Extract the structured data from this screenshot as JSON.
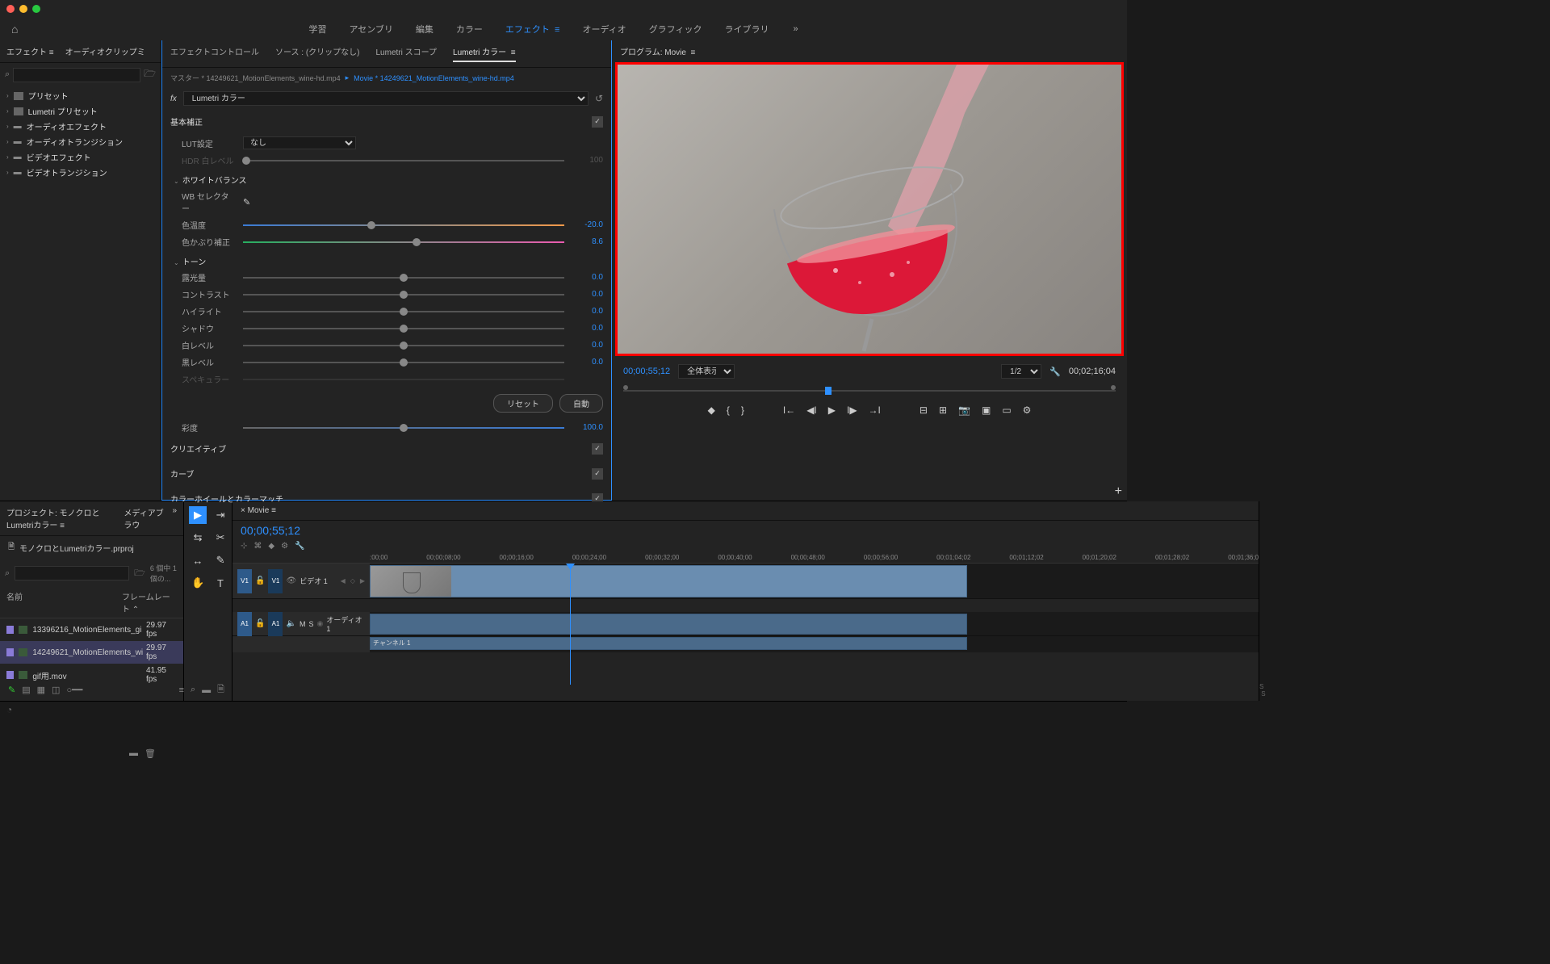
{
  "workspace_tabs": [
    "学習",
    "アセンブリ",
    "編集",
    "カラー",
    "エフェクト",
    "オーディオ",
    "グラフィック",
    "ライブラリ"
  ],
  "workspace_active": 4,
  "effects_panel": {
    "tab1": "エフェクト",
    "tab2": "オーディオクリップミ",
    "search_placeholder": "",
    "tree": [
      "プリセット",
      "Lumetri プリセット",
      "オーディオエフェクト",
      "オーディオトランジション",
      "ビデオエフェクト",
      "ビデオトランジション"
    ]
  },
  "center": {
    "tabs": [
      "エフェクトコントロール",
      "ソース : (クリップなし)",
      "Lumetri スコープ",
      "Lumetri カラー"
    ],
    "active": 3,
    "master": "マスター * 14249621_MotionElements_wine-hd.mp4",
    "clip": "Movie * 14249621_MotionElements_wine-hd.mp4",
    "fx_name": "Lumetri カラー",
    "basic": "基本補正",
    "lut_label": "LUT設定",
    "lut_value": "なし",
    "hdr_label": "HDR 白レベル",
    "hdr_value": "100",
    "wb_header": "ホワイトバランス",
    "wb_selector": "WB セレクター",
    "temp_label": "色温度",
    "temp_value": "-20.0",
    "tint_label": "色かぶり補正",
    "tint_value": "8.6",
    "tone_header": "トーン",
    "exposure_label": "露光量",
    "exposure_value": "0.0",
    "contrast_label": "コントラスト",
    "contrast_value": "0.0",
    "highlights_label": "ハイライト",
    "highlights_value": "0.0",
    "shadows_label": "シャドウ",
    "shadows_value": "0.0",
    "whites_label": "白レベル",
    "whites_value": "0.0",
    "blacks_label": "黒レベル",
    "blacks_value": "0.0",
    "specular_label": "スペキュラー",
    "reset_btn": "リセット",
    "auto_btn": "自動",
    "saturation_label": "彩度",
    "saturation_value": "100.0",
    "creative": "クリエイティブ",
    "curves": "カーブ",
    "wheels": "カラーホイールとカラーマッチ"
  },
  "program": {
    "title": "プログラム: Movie",
    "tc_current": "00;00;55;12",
    "display": "全体表示",
    "res": "1/2",
    "tc_total": "00;02;16;04"
  },
  "project": {
    "tab1": "プロジェクト: モノクロとLumetriカラー",
    "tab2": "メディアブラウ",
    "filename": "モノクロとLumetriカラー.prproj",
    "count": "6 個中 1 個の...",
    "col_name": "名前",
    "col_fps": "フレームレート",
    "clips": [
      {
        "name": "13396216_MotionElements_gi",
        "fps": "29.97 fps"
      },
      {
        "name": "14249621_MotionElements_wi",
        "fps": "29.97 fps"
      },
      {
        "name": "gif用.mov",
        "fps": "41.95 fps"
      }
    ]
  },
  "timeline": {
    "tab": "Movie",
    "tc": "00;00;55;12",
    "ruler": [
      ":00;00",
      "00;00;08;00",
      "00;00;16;00",
      "00;00;24;00",
      "00;00;32;00",
      "00;00;40;00",
      "00;00;48;00",
      "00;00;56;00",
      "00;01;04;02",
      "00;01;12;02",
      "00;01;20;02",
      "00;01;28;02",
      "00;01;36;0"
    ],
    "v1": "V1",
    "video1": "ビデオ 1",
    "a1": "A1",
    "audio1": "オーディオ 1",
    "channel1": "チャンネル 1",
    "m": "M",
    "s": "S"
  }
}
